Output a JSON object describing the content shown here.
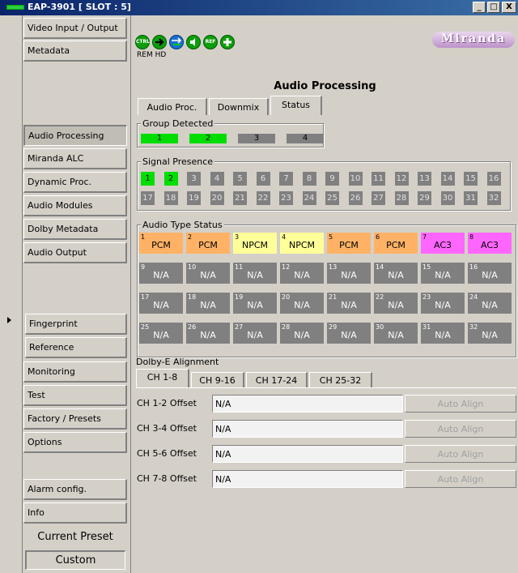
{
  "window": {
    "title": "EAP-3901 [ SLOT : 5]",
    "buttons": [
      "_",
      "□",
      "X"
    ]
  },
  "sidebar": {
    "items": [
      {
        "label": "Video Input / Output"
      },
      {
        "label": "Metadata"
      },
      {
        "label": "Audio Processing",
        "active": true
      },
      {
        "label": "Miranda ALC"
      },
      {
        "label": "Dynamic Proc."
      },
      {
        "label": "Audio Modules"
      },
      {
        "label": "Dolby Metadata"
      },
      {
        "label": "Audio Output"
      },
      {
        "label": "Fingerprint"
      },
      {
        "label": "Reference"
      },
      {
        "label": "Monitoring"
      },
      {
        "label": "Test"
      },
      {
        "label": "Factory / Presets"
      },
      {
        "label": "Options"
      },
      {
        "label": "Alarm config."
      },
      {
        "label": "Info"
      }
    ],
    "current_preset_label": "Current Preset",
    "current_preset_value": "Custom"
  },
  "header": {
    "icons": [
      "CTRL",
      "arrow-icon",
      "arrows-icon",
      "audio-icon",
      "REF",
      "plus-icon"
    ],
    "ctrl_text": "CTRL",
    "ref_text": "REF",
    "rem_hd": "REM  HD",
    "logo": "Miranda"
  },
  "main": {
    "title": "Audio Processing",
    "tabs": [
      "Audio Proc.",
      "Downmix",
      "Status"
    ],
    "selected_tab": "Status",
    "group_detected": {
      "title": "Group Detected",
      "groups": [
        {
          "label": "1",
          "color": "#00dd00"
        },
        {
          "label": "2",
          "color": "#00dd00"
        },
        {
          "label": "3",
          "color": "#808080"
        },
        {
          "label": "4",
          "color": "#808080"
        }
      ]
    },
    "signal_presence": {
      "title": "Signal Presence",
      "channels": [
        "1",
        "2",
        "3",
        "4",
        "5",
        "6",
        "7",
        "8",
        "9",
        "10",
        "11",
        "12",
        "13",
        "14",
        "15",
        "16",
        "17",
        "18",
        "19",
        "20",
        "21",
        "22",
        "23",
        "24",
        "25",
        "26",
        "27",
        "28",
        "29",
        "30",
        "31",
        "32"
      ],
      "active": [
        "1",
        "2"
      ],
      "active_color": "#00dd00",
      "inactive_color": "#808080"
    },
    "audio_type_status": {
      "title": "Audio Type Status",
      "channels": [
        {
          "n": "1",
          "type": "PCM"
        },
        {
          "n": "2",
          "type": "PCM"
        },
        {
          "n": "3",
          "type": "NPCM"
        },
        {
          "n": "4",
          "type": "NPCM"
        },
        {
          "n": "5",
          "type": "PCM"
        },
        {
          "n": "6",
          "type": "PCM"
        },
        {
          "n": "7",
          "type": "AC3"
        },
        {
          "n": "8",
          "type": "AC3"
        },
        {
          "n": "9",
          "type": "N/A"
        },
        {
          "n": "10",
          "type": "N/A"
        },
        {
          "n": "11",
          "type": "N/A"
        },
        {
          "n": "12",
          "type": "N/A"
        },
        {
          "n": "13",
          "type": "N/A"
        },
        {
          "n": "14",
          "type": "N/A"
        },
        {
          "n": "15",
          "type": "N/A"
        },
        {
          "n": "16",
          "type": "N/A"
        },
        {
          "n": "17",
          "type": "N/A"
        },
        {
          "n": "18",
          "type": "N/A"
        },
        {
          "n": "19",
          "type": "N/A"
        },
        {
          "n": "20",
          "type": "N/A"
        },
        {
          "n": "21",
          "type": "N/A"
        },
        {
          "n": "22",
          "type": "N/A"
        },
        {
          "n": "23",
          "type": "N/A"
        },
        {
          "n": "24",
          "type": "N/A"
        },
        {
          "n": "25",
          "type": "N/A"
        },
        {
          "n": "26",
          "type": "N/A"
        },
        {
          "n": "27",
          "type": "N/A"
        },
        {
          "n": "28",
          "type": "N/A"
        },
        {
          "n": "29",
          "type": "N/A"
        },
        {
          "n": "30",
          "type": "N/A"
        },
        {
          "n": "31",
          "type": "N/A"
        },
        {
          "n": "32",
          "type": "N/A"
        }
      ],
      "colors": {
        "PCM": "#ffb266",
        "NPCM": "#ffff99",
        "AC3": "#ff66ff",
        "N/A": "#808080"
      }
    },
    "dolby_e": {
      "title": "Dolby-E Alignment",
      "tabs": [
        "CH 1-8",
        "CH 9-16",
        "CH 17-24",
        "CH 25-32"
      ],
      "selected_tab": "CH 1-8",
      "rows": [
        {
          "label": "CH 1-2 Offset",
          "value": "N/A",
          "button": "Auto Align"
        },
        {
          "label": "CH 3-4 Offset",
          "value": "N/A",
          "button": "Auto Align"
        },
        {
          "label": "CH 5-6 Offset",
          "value": "N/A",
          "button": "Auto Align"
        },
        {
          "label": "CH 7-8 Offset",
          "value": "N/A",
          "button": "Auto Align"
        }
      ]
    }
  }
}
